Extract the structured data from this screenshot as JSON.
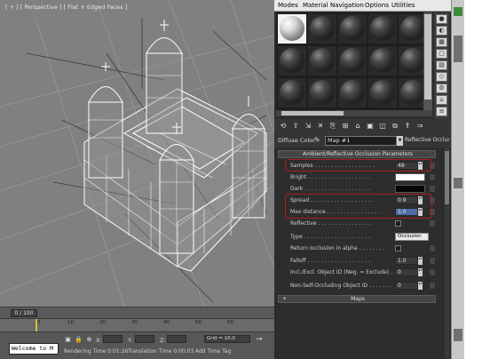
{
  "viewport": {
    "label": "[ + ] [ Perspective ] [ Flat + Edged Faces ]"
  },
  "time_slider": {
    "value": "0 / 100"
  },
  "timeline": {
    "ticks": [
      "0",
      "10",
      "20",
      "30",
      "40",
      "50",
      "60"
    ]
  },
  "status_bar": {
    "maxscript_text": "Welcome to M",
    "x_label": "X:",
    "y_label": "Y:",
    "z_label": "Z:",
    "grid": "Grid = 10.0",
    "rendering_time": "Rendering Time  0:01:26",
    "translation_time": "Translation Time  0:00:03",
    "add_time_tag": "Add Time Tag"
  },
  "material_editor": {
    "menus": [
      "Modes",
      "Material",
      "Navigation",
      "Options",
      "Utilities"
    ],
    "diffuse_label": "Diffuse Color:",
    "material_name": "Map #1",
    "material_type": "Reflective Occlusion",
    "rollout_title": "Ambient/Reflective Occlusion Parameters",
    "params": [
      {
        "label": "Samples . . . . . . . . . . . . . . . . . .",
        "value": "48"
      },
      {
        "label": "Bright . . . . . . . . . . . . . . . . . . .",
        "swatch": "#ffffff"
      },
      {
        "label": "Dark . . . . . . . . . . . . . . . . . . . .",
        "swatch": "#050505"
      },
      {
        "label": "Spread . . . . . . . . . . . . . . . . . . .",
        "value": "0.9"
      },
      {
        "label": "Max distance . . . . . . . . . . . . . . . .",
        "value": "5.0"
      },
      {
        "label": "Reflective . . . . . . . . . . . . . . . .",
        "check": true
      },
      {
        "label": "Type . . . . . . . . . . . . . . . . . . . .",
        "dropdown": "Occlusion"
      },
      {
        "label": "Return occlusion in alpha . . . . . . . .",
        "check": true
      },
      {
        "label": "Falloff . . . . . . . . . . . . . . . . . . .",
        "value": "1.0"
      },
      {
        "label": "Incl./Excl. Object ID (Neg. = Exclude) . .",
        "value": "0"
      },
      {
        "label": "Non-Self-Occluding Object ID . . . . . . .",
        "value": "0"
      }
    ],
    "maps_title": "Maps",
    "maps_expander": "+"
  },
  "colors": {
    "highlight_frame": "#b01c1c",
    "selected_field": "#4d6ea6"
  },
  "icons": [
    "picker-icon",
    "key-icon",
    "lock-icon",
    "sample-sphere"
  ]
}
